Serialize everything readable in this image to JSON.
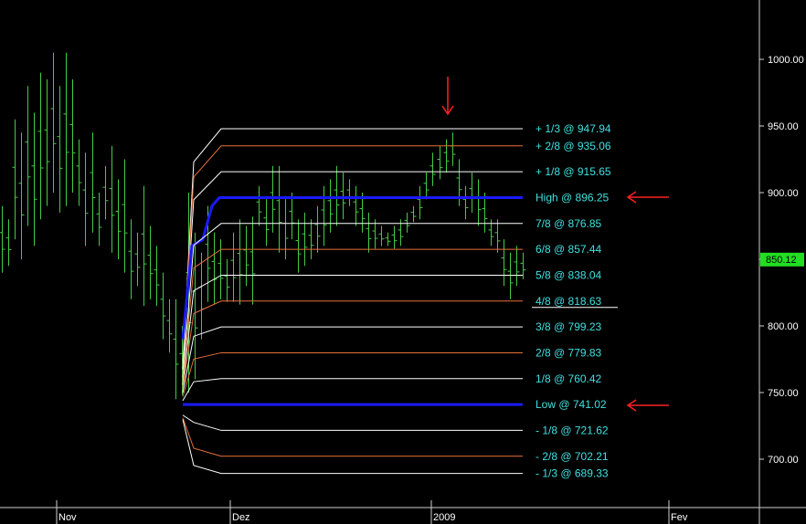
{
  "chart_data": {
    "type": "line",
    "title": "",
    "xlabel": "",
    "ylabel": "",
    "ylim": [
      663,
      1040
    ],
    "y_ticks": [
      "1000.00",
      "950.00",
      "900.00",
      "850.00",
      "800.00",
      "750.00",
      "700.00"
    ],
    "y_tick_values": [
      1000,
      950,
      900,
      850,
      800,
      750,
      700
    ],
    "x_ticks": [
      "Nov",
      "Dez",
      "2009",
      "Fev"
    ],
    "last_price": "850.12",
    "last_price_value": 850.12,
    "levels": [
      {
        "label": "+ 1/3 @ 947.94",
        "value": 947.94,
        "color": "#ffffff",
        "width": 1
      },
      {
        "label": "+ 2/8 @ 935.06",
        "value": 935.06,
        "color": "#e8703a",
        "width": 1
      },
      {
        "label": "+ 1/8 @ 915.65",
        "value": 915.65,
        "color": "#ffffff",
        "width": 1
      },
      {
        "label": "High @ 896.25",
        "value": 896.25,
        "color": "#1a1aff",
        "width": 3
      },
      {
        "label": "7/8 @ 876.85",
        "value": 876.85,
        "color": "#ffffff",
        "width": 1
      },
      {
        "label": "6/8 @ 857.44",
        "value": 857.44,
        "color": "#e8703a",
        "width": 1
      },
      {
        "label": "5/8 @ 838.04",
        "value": 838.04,
        "color": "#ffffff",
        "width": 1
      },
      {
        "label": "4/8 @ 818.63",
        "value": 818.63,
        "color": "#e8703a",
        "width": 1
      },
      {
        "label": "3/8 @ 799.23",
        "value": 799.23,
        "color": "#ffffff",
        "width": 1
      },
      {
        "label": "2/8 @ 779.83",
        "value": 779.83,
        "color": "#e8703a",
        "width": 1
      },
      {
        "label": "1/8 @ 760.42",
        "value": 760.42,
        "color": "#ffffff",
        "width": 1
      },
      {
        "label": "Low  @ 741.02",
        "value": 741.02,
        "color": "#1a1aff",
        "width": 3
      },
      {
        "label": "- 1/8 @ 721.62",
        "value": 721.62,
        "color": "#ffffff",
        "width": 1
      },
      {
        "label": "- 2/8 @ 702.21",
        "value": 702.21,
        "color": "#e8703a",
        "width": 1
      },
      {
        "label": "- 1/3 @ 689.33",
        "value": 689.33,
        "color": "#ffffff",
        "width": 1
      }
    ],
    "series": [
      {
        "values": [
          [
            840,
            890
          ],
          [
            845,
            880
          ],
          [
            865,
            955
          ],
          [
            850,
            945
          ],
          [
            875,
            980
          ],
          [
            860,
            960
          ],
          [
            880,
            990
          ],
          [
            890,
            985
          ],
          [
            900,
            1005
          ],
          [
            885,
            980
          ],
          [
            890,
            1005
          ],
          [
            900,
            985
          ],
          [
            890,
            940
          ],
          [
            860,
            930
          ],
          [
            870,
            945
          ],
          [
            860,
            900
          ],
          [
            880,
            920
          ],
          [
            855,
            935
          ],
          [
            850,
            910
          ],
          [
            840,
            925
          ],
          [
            820,
            880
          ],
          [
            830,
            870
          ],
          [
            815,
            905
          ],
          [
            820,
            875
          ],
          [
            815,
            860
          ],
          [
            790,
            840
          ],
          [
            780,
            820
          ],
          [
            745,
            820
          ],
          [
            748,
            800
          ],
          [
            750,
            900
          ],
          [
            760,
            870
          ],
          [
            790,
            855
          ],
          [
            818,
            890
          ],
          [
            816,
            870
          ],
          [
            820,
            865
          ],
          [
            818,
            850
          ],
          [
            818,
            870
          ],
          [
            816,
            880
          ],
          [
            830,
            875
          ],
          [
            816,
            882
          ],
          [
            875,
            905
          ],
          [
            860,
            895
          ],
          [
            870,
            920
          ],
          [
            855,
            920
          ],
          [
            850,
            895
          ],
          [
            865,
            900
          ],
          [
            840,
            880
          ],
          [
            845,
            885
          ],
          [
            850,
            880
          ],
          [
            855,
            890
          ],
          [
            860,
            905
          ],
          [
            870,
            910
          ],
          [
            875,
            920
          ],
          [
            880,
            915
          ],
          [
            890,
            910
          ],
          [
            875,
            905
          ],
          [
            870,
            900
          ],
          [
            855,
            885
          ],
          [
            858,
            880
          ],
          [
            860,
            875
          ],
          [
            860,
            870
          ],
          [
            858,
            875
          ],
          [
            860,
            880
          ],
          [
            870,
            885
          ],
          [
            878,
            890
          ],
          [
            880,
            905
          ],
          [
            895,
            915
          ],
          [
            905,
            930
          ],
          [
            910,
            935
          ],
          [
            915,
            940
          ],
          [
            920,
            945
          ],
          [
            890,
            925
          ],
          [
            880,
            905
          ],
          [
            885,
            915
          ],
          [
            875,
            910
          ],
          [
            870,
            900
          ],
          [
            860,
            880
          ],
          [
            855,
            880
          ],
          [
            830,
            865
          ],
          [
            820,
            855
          ],
          [
            830,
            860
          ],
          [
            835,
            855
          ]
        ]
      }
    ]
  }
}
